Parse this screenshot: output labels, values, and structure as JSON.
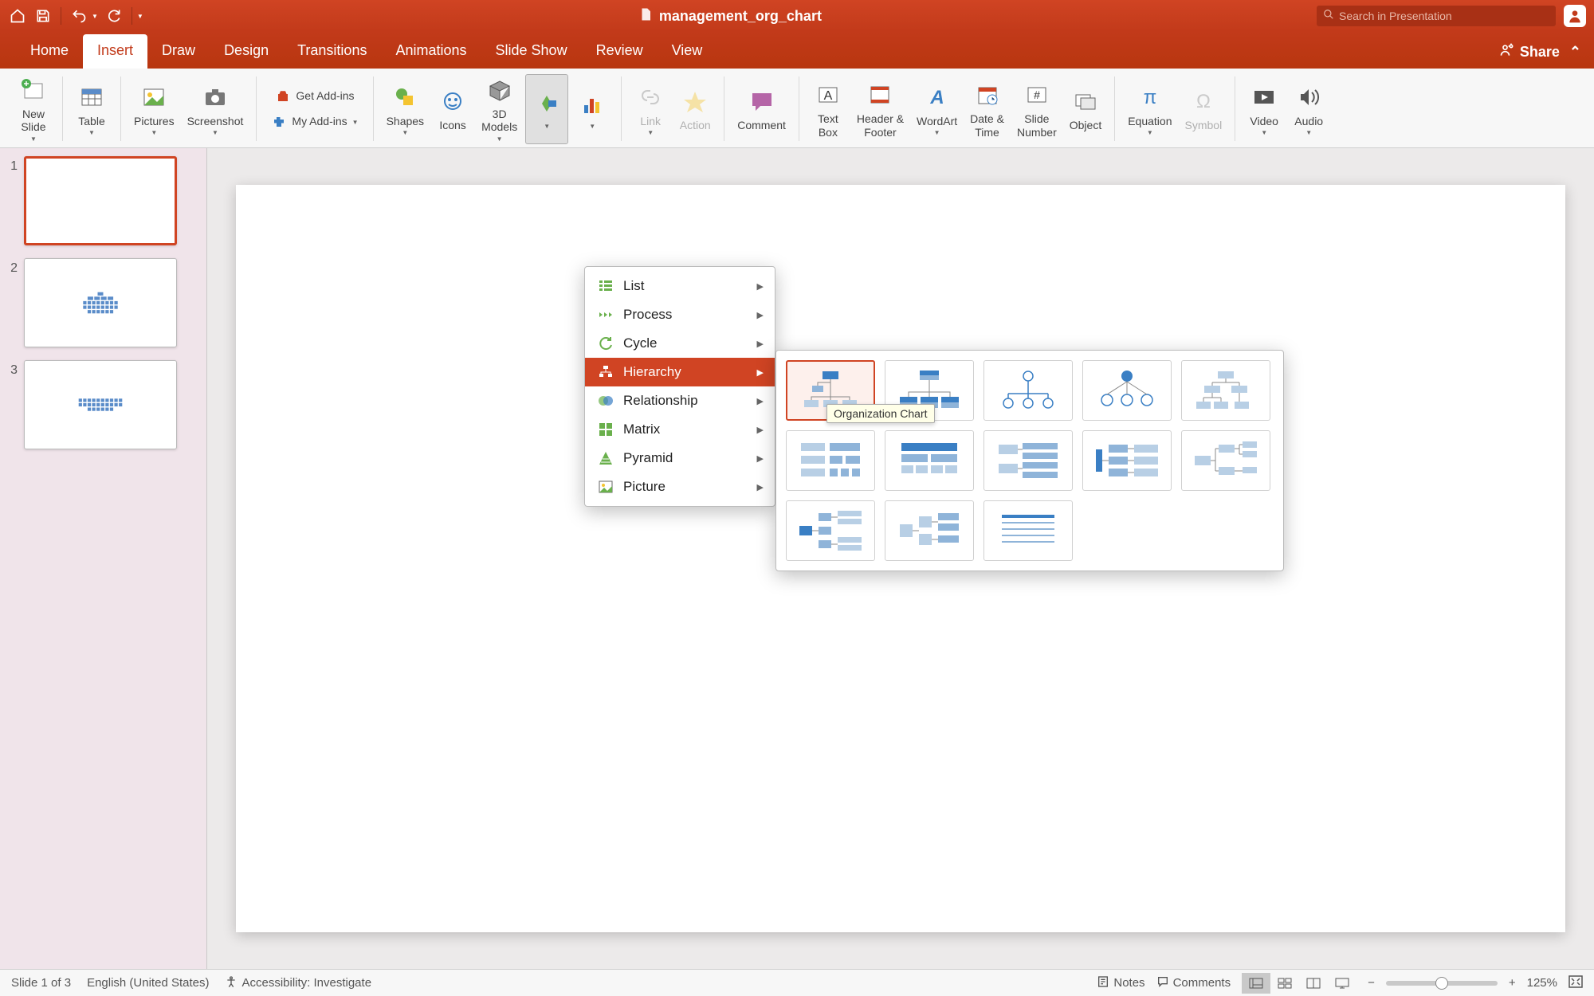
{
  "titlebar": {
    "filename": "management_org_chart",
    "search_placeholder": "Search in Presentation"
  },
  "tabs": {
    "items": [
      "Home",
      "Insert",
      "Draw",
      "Design",
      "Transitions",
      "Animations",
      "Slide Show",
      "Review",
      "View"
    ],
    "active_index": 1,
    "share_label": "Share"
  },
  "ribbon": {
    "new_slide": "New\nSlide",
    "table": "Table",
    "pictures": "Pictures",
    "screenshot": "Screenshot",
    "get_addins": "Get Add-ins",
    "my_addins": "My Add-ins",
    "shapes": "Shapes",
    "icons": "Icons",
    "models": "3D\nModels",
    "link": "Link",
    "action": "Action",
    "comment": "Comment",
    "text_box": "Text\nBox",
    "header_footer": "Header &\nFooter",
    "wordart": "WordArt",
    "date_time": "Date &\nTime",
    "slide_number": "Slide\nNumber",
    "object": "Object",
    "equation": "Equation",
    "symbol": "Symbol",
    "video": "Video",
    "audio": "Audio"
  },
  "thumbnails": {
    "count": 3,
    "selected_index": 0
  },
  "smartart_menu": {
    "items": [
      "List",
      "Process",
      "Cycle",
      "Hierarchy",
      "Relationship",
      "Matrix",
      "Pyramid",
      "Picture"
    ],
    "highlighted_index": 3
  },
  "smartart_gallery": {
    "selected_index": 0,
    "tooltip": "Organization Chart",
    "count": 13
  },
  "statusbar": {
    "slide_info": "Slide 1 of 3",
    "language": "English (United States)",
    "accessibility": "Accessibility: Investigate",
    "notes": "Notes",
    "comments": "Comments",
    "zoom": "125%"
  },
  "colors": {
    "brand": "#d04423",
    "chart_blue": "#5a8cc9"
  }
}
